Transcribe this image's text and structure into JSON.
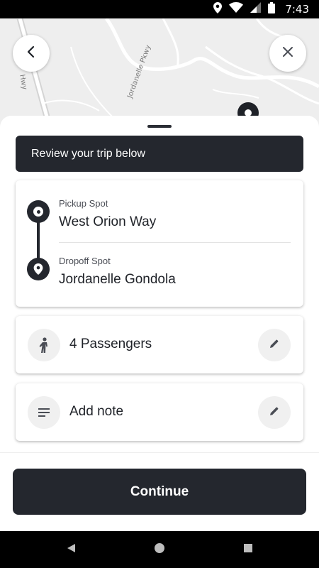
{
  "status_bar": {
    "time": "7:43",
    "icons": [
      "location-icon",
      "wifi-icon",
      "signal-icon",
      "battery-icon"
    ]
  },
  "map": {
    "labels": {
      "hwy": "Hwy",
      "pkwy": "Jordanelle Pkwy"
    }
  },
  "header": {
    "back_icon": "chevron-left-icon",
    "close_icon": "close-icon"
  },
  "banner": {
    "text": "Review your trip below"
  },
  "route": {
    "pickup_label": "Pickup Spot",
    "pickup_value": "West Orion Way",
    "dropoff_label": "Dropoff Spot",
    "dropoff_value": "Jordanelle Gondola"
  },
  "passengers": {
    "text": "4 Passengers",
    "icon": "person-icon",
    "edit_icon": "pencil-icon"
  },
  "note": {
    "text": "Add note",
    "icon": "notes-icon",
    "edit_icon": "pencil-icon"
  },
  "actions": {
    "continue_label": "Continue"
  },
  "colors": {
    "primary": "#24272e",
    "surface": "#ffffff",
    "icon_bg": "#f0f0f0",
    "map_bg": "#eeeeee"
  }
}
